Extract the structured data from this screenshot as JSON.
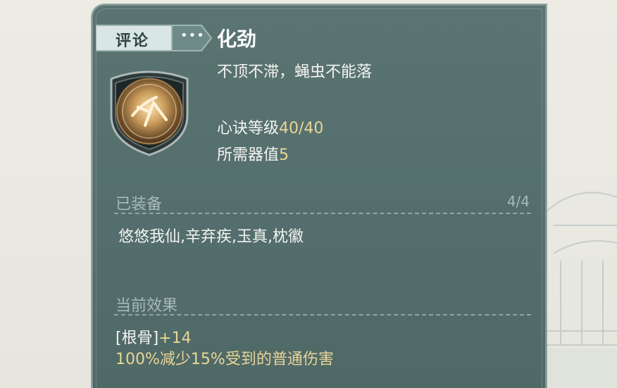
{
  "panel": {
    "tag": {
      "label": "评论",
      "dots": "•••"
    },
    "title": "化劲",
    "emblem_icon": "martial-emblem-icon",
    "description": "不顶不滞，蝇虫不能落",
    "level": {
      "label": "心诀等级",
      "value": "40/40"
    },
    "required": {
      "label": "所需器值",
      "value": "5"
    }
  },
  "equipped": {
    "heading": "已装备",
    "count": "4/4",
    "names": "悠悠我仙,辛弃疾,玉真,枕徽"
  },
  "effects": {
    "heading": "当前效果",
    "stat_label": "[根骨]",
    "stat_value": "+14",
    "line2_pct1": "100%",
    "line2_mid": "减少",
    "line2_pct2": "15%",
    "line2_tail": "受到的普通伤害"
  },
  "colors": {
    "panel_bg": "#55706e",
    "gold_text": "#e9d596",
    "muted_text": "#a9bab8"
  }
}
